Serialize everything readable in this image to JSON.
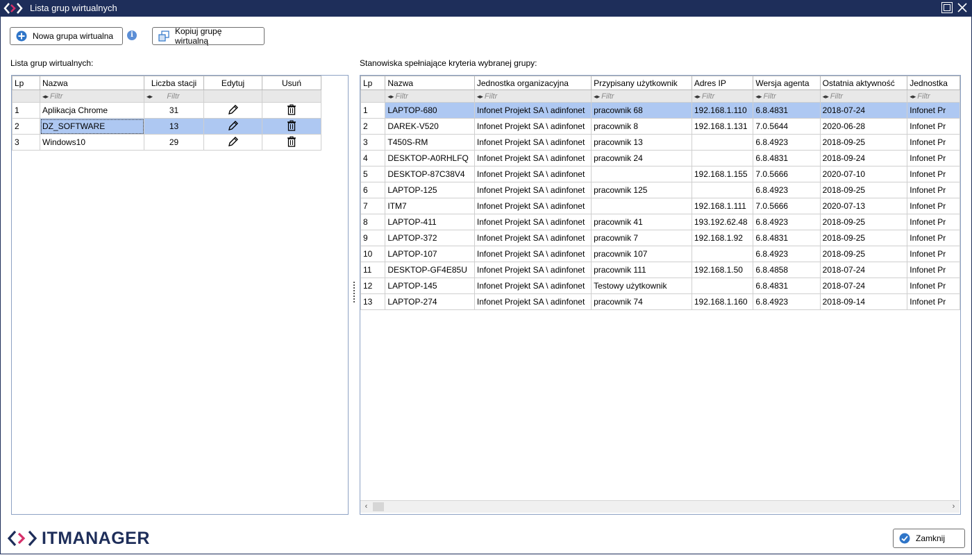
{
  "window": {
    "title": "Lista grup wirtualnych"
  },
  "toolbar": {
    "new_group_label": "Nowa grupa wirtualna",
    "copy_group_label": "Kopiuj grupę wirtualną"
  },
  "left_panel": {
    "caption": "Lista grup wirtualnych:",
    "columns": [
      "Lp",
      "Nazwa",
      "Liczba stacji",
      "Edytuj",
      "Usuń"
    ],
    "filter_placeholder": "Filtr",
    "rows": [
      {
        "lp": "1",
        "nazwa": "Aplikacja Chrome",
        "liczba": "31"
      },
      {
        "lp": "2",
        "nazwa": "DZ_SOFTWARE",
        "liczba": "13",
        "selected": true
      },
      {
        "lp": "3",
        "nazwa": "Windows10",
        "liczba": "29"
      }
    ]
  },
  "right_panel": {
    "caption": "Stanowiska spełniające kryteria wybranej grupy:",
    "columns": [
      "Lp",
      "Nazwa",
      "Jednostka organizacyjna",
      "Przypisany użytkownik",
      "Adres IP",
      "Wersja agenta",
      "Ostatnia aktywność",
      "Jednostka"
    ],
    "filter_placeholder": "Filtr",
    "rows": [
      [
        "1",
        "LAPTOP-680",
        "Infonet Projekt SA \\ adinfonet",
        "pracownik 68",
        "192.168.1.110",
        "6.8.4831",
        "2018-07-24",
        "Infonet Pr"
      ],
      [
        "2",
        "DAREK-V520",
        "Infonet Projekt SA \\ adinfonet",
        "pracownik 8",
        "192.168.1.131",
        "7.0.5644",
        "2020-06-28",
        "Infonet Pr"
      ],
      [
        "3",
        "T450S-RM",
        "Infonet Projekt SA \\ adinfonet",
        "pracownik 13",
        "",
        "6.8.4923",
        "2018-09-25",
        "Infonet Pr"
      ],
      [
        "4",
        "DESKTOP-A0RHLFQ",
        "Infonet Projekt SA \\ adinfonet",
        "pracownik 24",
        "",
        "6.8.4831",
        "2018-09-24",
        "Infonet Pr"
      ],
      [
        "5",
        "DESKTOP-87C38V4",
        "Infonet Projekt SA \\ adinfonet",
        "",
        "192.168.1.155",
        "7.0.5666",
        "2020-07-10",
        "Infonet Pr"
      ],
      [
        "6",
        "LAPTOP-125",
        "Infonet Projekt SA \\ adinfonet",
        "pracownik 125",
        "",
        "6.8.4923",
        "2018-09-25",
        "Infonet Pr"
      ],
      [
        "7",
        "ITM7",
        "Infonet Projekt SA \\ adinfonet",
        "",
        "192.168.1.111",
        "7.0.5666",
        "2020-07-13",
        "Infonet Pr"
      ],
      [
        "8",
        "LAPTOP-411",
        "Infonet Projekt SA \\ adinfonet",
        "pracownik 41",
        "193.192.62.48",
        "6.8.4923",
        "2018-09-25",
        "Infonet Pr"
      ],
      [
        "9",
        "LAPTOP-372",
        "Infonet Projekt SA \\ adinfonet",
        "pracownik 7",
        "192.168.1.92",
        "6.8.4831",
        "2018-09-25",
        "Infonet Pr"
      ],
      [
        "10",
        "LAPTOP-107",
        "Infonet Projekt SA \\ adinfonet",
        "pracownik 107",
        "",
        "6.8.4923",
        "2018-09-25",
        "Infonet Pr"
      ],
      [
        "11",
        "DESKTOP-GF4E85U",
        "Infonet Projekt SA \\ adinfonet",
        "pracownik 111",
        "192.168.1.50",
        "6.8.4858",
        "2018-07-24",
        "Infonet Pr"
      ],
      [
        "12",
        "LAPTOP-145",
        "Infonet Projekt SA \\ adinfonet",
        "Testowy użytkownik",
        "",
        "6.8.4831",
        "2018-07-24",
        "Infonet Pr"
      ],
      [
        "13",
        "LAPTOP-274",
        "Infonet Projekt SA \\ adinfonet",
        "pracownik 74",
        "192.168.1.160",
        "6.8.4923",
        "2018-09-14",
        "Infonet Pr"
      ]
    ],
    "selected_row": 0
  },
  "footer": {
    "brand_prefix": "ITM",
    "brand_suffix": "ANAGER",
    "close_label": "Zamknij"
  },
  "colors": {
    "titlebar": "#1e2e5a",
    "selection": "#aec8f2",
    "accent": "#2f75c8"
  }
}
